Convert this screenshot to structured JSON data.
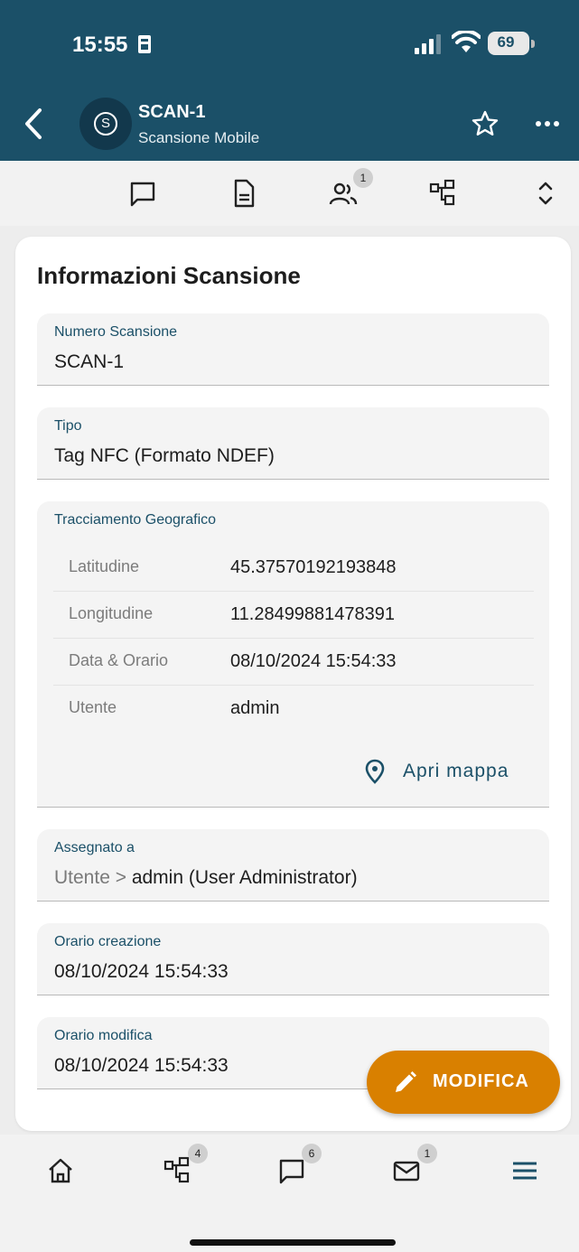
{
  "status_bar": {
    "time": "15:55",
    "battery": "69",
    "time_icon": "id-card-icon",
    "signal_icon": "cellular-signal-icon",
    "wifi_icon": "wifi-icon"
  },
  "header": {
    "title": "SCAN-1",
    "subtitle": "Scansione Mobile",
    "avatar_letter": "S",
    "colors": {
      "background": "#1b5068",
      "avatar": "#12384c"
    }
  },
  "toolbar": {
    "items": [
      {
        "icon": "comment-icon"
      },
      {
        "icon": "document-icon"
      },
      {
        "icon": "users-icon",
        "badge": "1"
      },
      {
        "icon": "hierarchy-icon"
      },
      {
        "icon": "expand-collapse-icon"
      }
    ]
  },
  "card": {
    "title": "Informazioni Scansione",
    "fields": {
      "numero": {
        "label": "Numero Scansione",
        "value": "SCAN-1"
      },
      "tipo": {
        "label": "Tipo",
        "value": "Tag NFC (Formato NDEF)"
      },
      "tracciamento": {
        "label": "Tracciamento Geografico",
        "rows": [
          {
            "key": "Latitudine",
            "value": "45.37570192193848"
          },
          {
            "key": "Longitudine",
            "value": "11.28499881478391"
          },
          {
            "key": "Data & Orario",
            "value": "08/10/2024 15:54:33"
          },
          {
            "key": "Utente",
            "value": "admin"
          }
        ],
        "map_link": "Apri mappa"
      },
      "assegnato": {
        "label": "Assegnato a",
        "prefix": "Utente >",
        "value": "admin (User Administrator)"
      },
      "creazione": {
        "label": "Orario creazione",
        "value": "08/10/2024 15:54:33"
      },
      "modifica": {
        "label": "Orario modifica",
        "value": "08/10/2024 15:54:33"
      }
    }
  },
  "fab": {
    "label": "MODIFICA",
    "color": "#d98000"
  },
  "bottom_nav": {
    "items": [
      {
        "icon": "home-icon"
      },
      {
        "icon": "hierarchy-icon",
        "badge": "4"
      },
      {
        "icon": "comment-icon",
        "badge": "6"
      },
      {
        "icon": "mail-icon",
        "badge": "1"
      },
      {
        "icon": "menu-icon"
      }
    ]
  }
}
